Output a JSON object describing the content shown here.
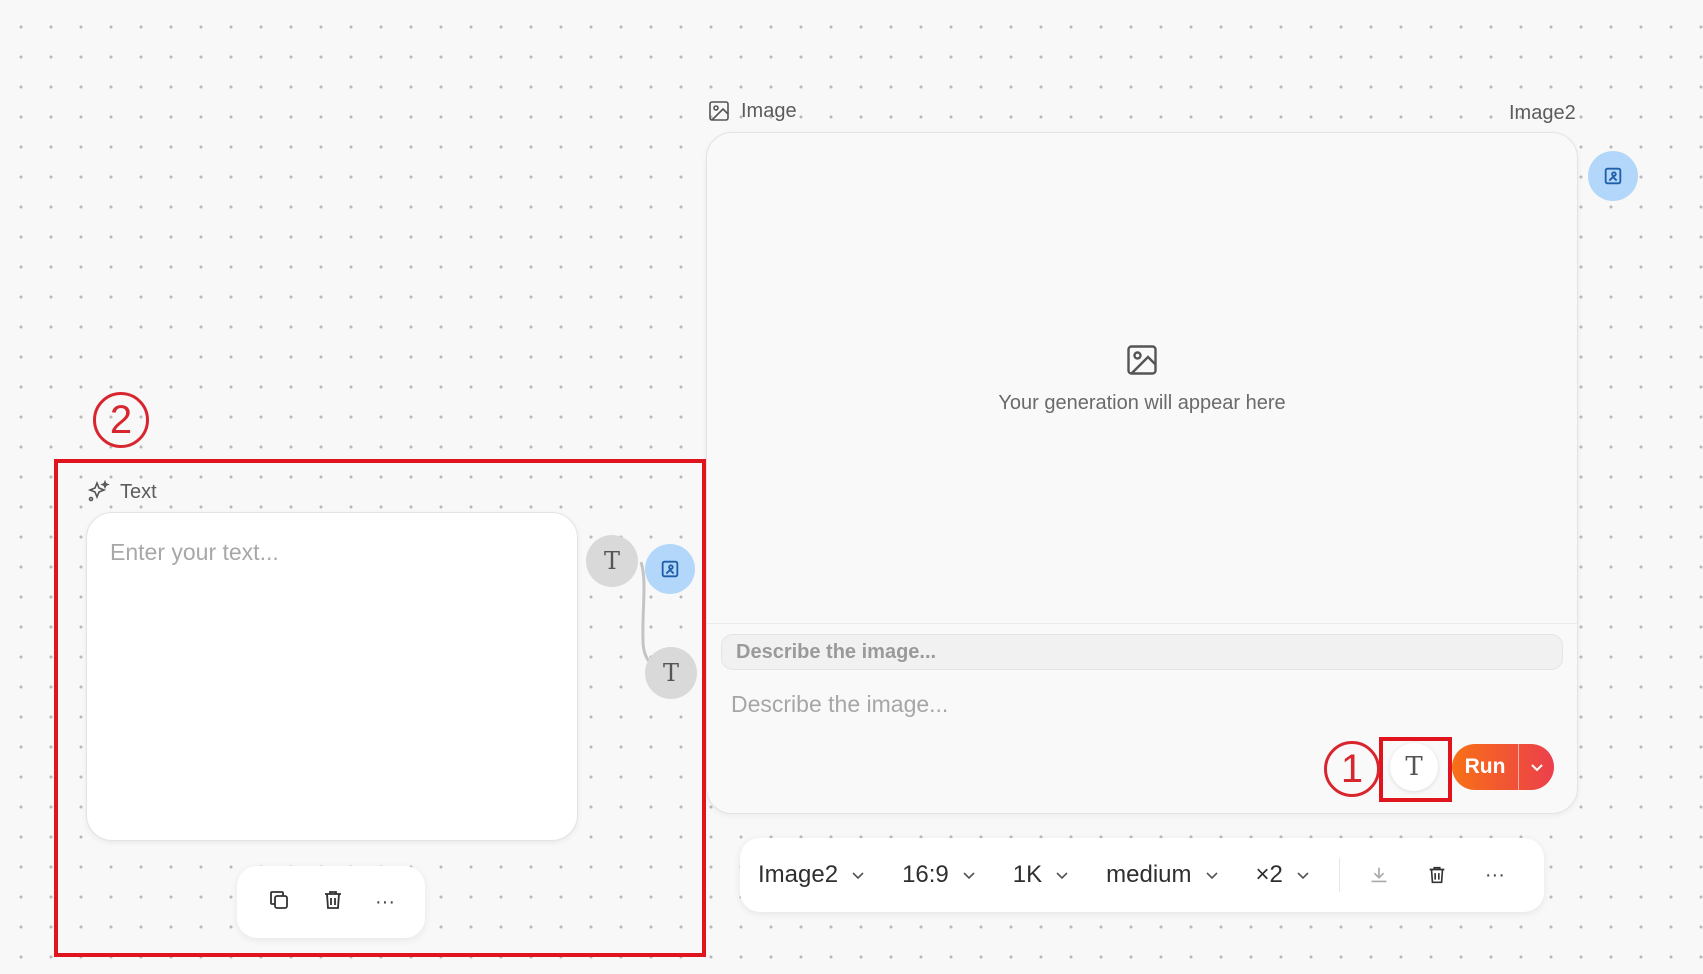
{
  "image_node": {
    "label": "Image",
    "model_name": "Image2",
    "preview_text": "Your generation will appear here",
    "prompt_chip": "Describe the image...",
    "prompt_placeholder": "Describe the image...",
    "text_button": "T",
    "run_label": "Run"
  },
  "image_toolbar": {
    "model": "Image2",
    "aspect": "16:9",
    "resolution": "1K",
    "quality": "medium",
    "count": "×2",
    "more": "···"
  },
  "text_node": {
    "label": "Text",
    "placeholder": "Enter your text...",
    "handle_letter": "T",
    "more": "···"
  },
  "annotations": {
    "one": "1",
    "two": "2"
  },
  "colors": {
    "accent_orange": "#f77016",
    "accent_red": "#ec3f4c",
    "annotation_red": "#e0141c",
    "handle_blue": "#b3d7fb"
  }
}
